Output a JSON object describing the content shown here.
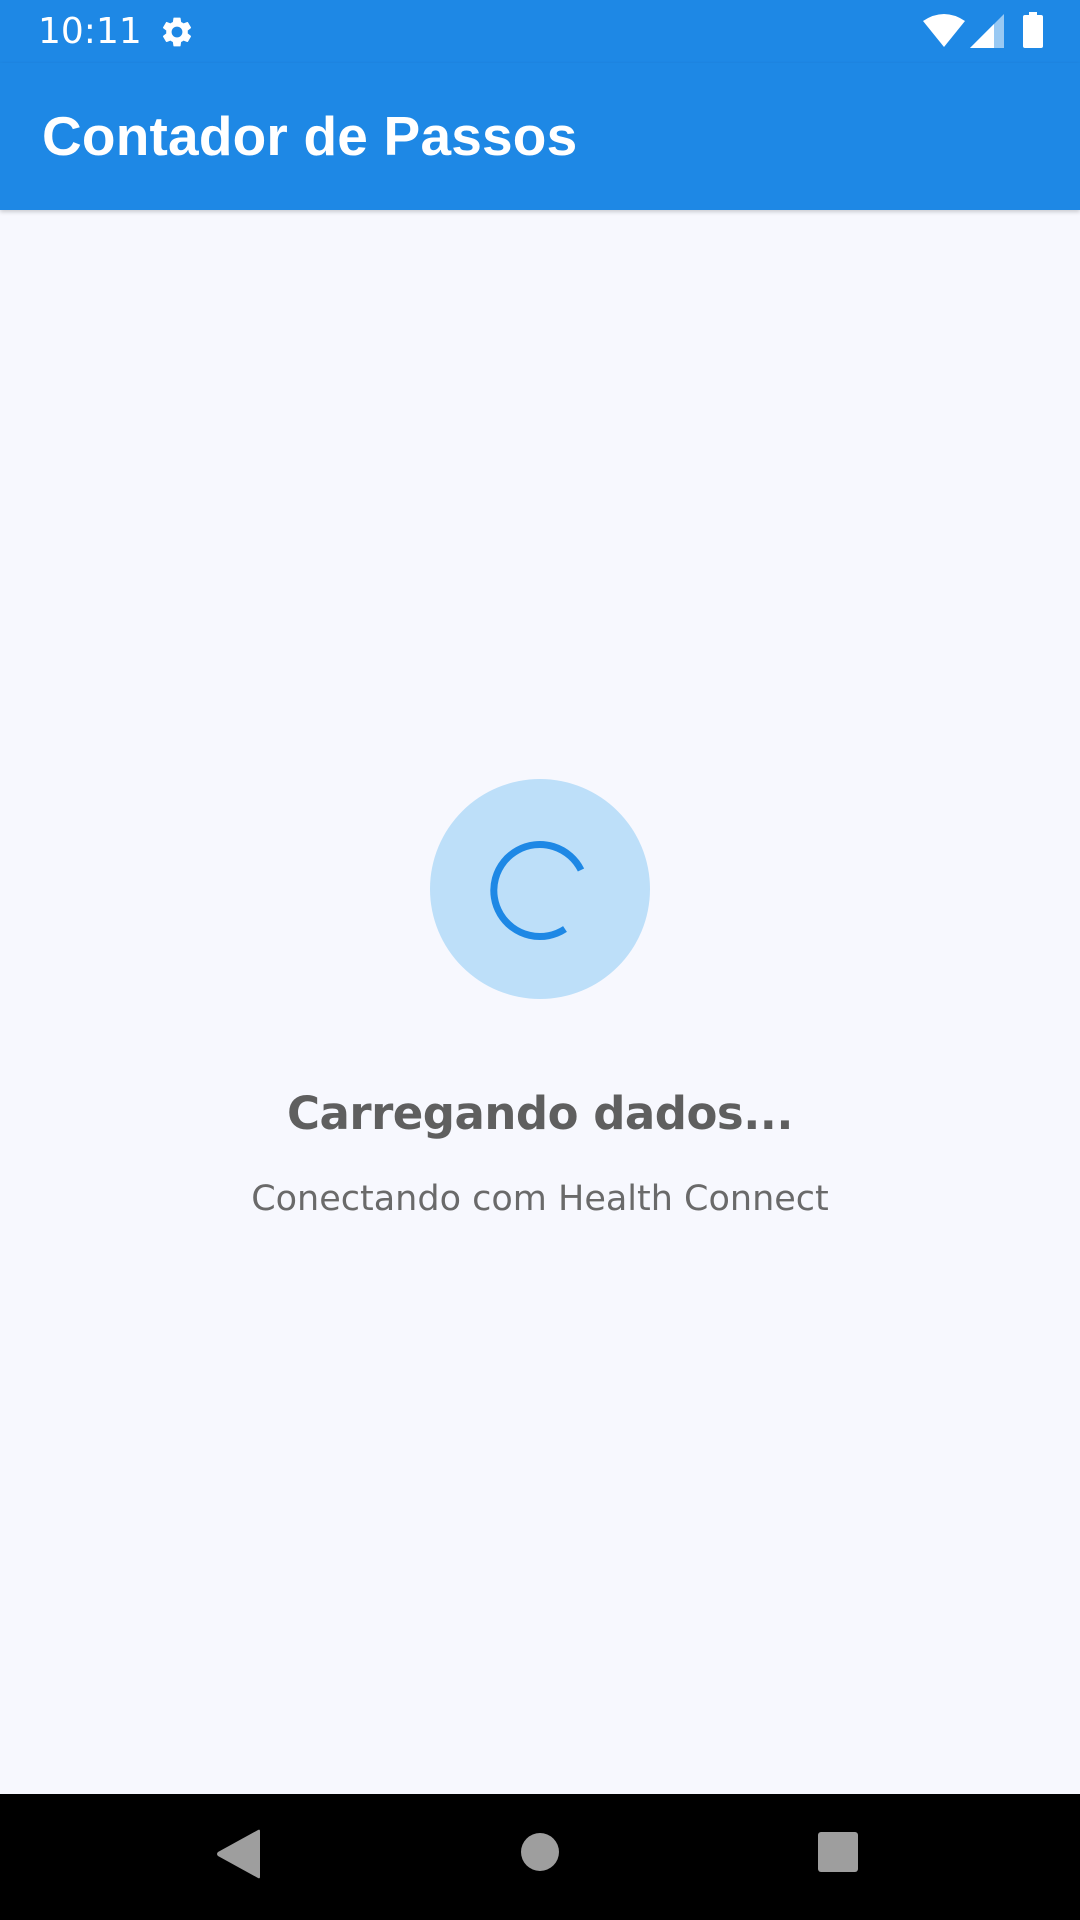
{
  "status_bar": {
    "time": "10:11",
    "icons": [
      "gear-icon",
      "wifi-icon",
      "signal-icon",
      "battery-icon"
    ]
  },
  "app_bar": {
    "title": "Contador de Passos",
    "color": "#1E88E5"
  },
  "loading": {
    "title": "Carregando dados...",
    "subtitle": "Conectando com Health Connect",
    "spinner_icon": "progress-spinner-icon",
    "accent_color": "#1E88E5",
    "badge_color": "#BDDFF9"
  },
  "nav_bar": {
    "icons": [
      "back-icon",
      "home-icon",
      "recents-icon"
    ]
  }
}
